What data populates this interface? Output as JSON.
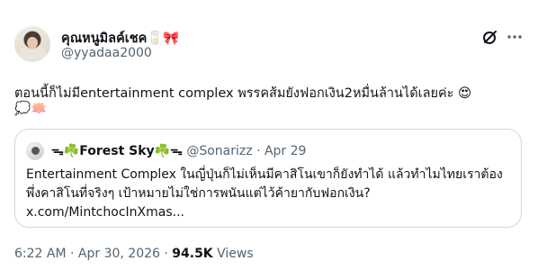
{
  "tweet": {
    "user_name": "คุณหนูมิลค์เชค🥛🎀",
    "handle": "@yyadaa2000",
    "text": "ตอนนี้ก็ไม่มีentertainment complex พรรคส้มยังฟอกเงิน2หมื่นล้านได้เลยค่ะ 😍",
    "text_line2": "💭🪷",
    "timestamp": "6:22 AM · Apr 30, 2026 ·",
    "views_count": "94.5K",
    "views_label": "Views"
  },
  "quote": {
    "name": "ᯓ☘️Forest Sky☘️ᯓ",
    "handle": "@Sonarizz",
    "date": "· Apr 29",
    "text": "Entertainment Complex ในญี่ปุ่นก็ไม่เห็นมีคาสิโนเขาก็ยังทำได้ แล้วทำไมไทยเราต้อง พึ่งคาสิโนที่จริงๆ เป้าหมายไม่ใช่การพนันแต่ไว้ค้ายากับฟอกเงิน? x.com/MintchocInXmas..."
  },
  "icons": {
    "grok": "grok-icon",
    "more": "more-icon"
  },
  "colors": {
    "secondary_text": "#536471",
    "primary_text": "#0f1419",
    "border": "#cfd9de"
  }
}
